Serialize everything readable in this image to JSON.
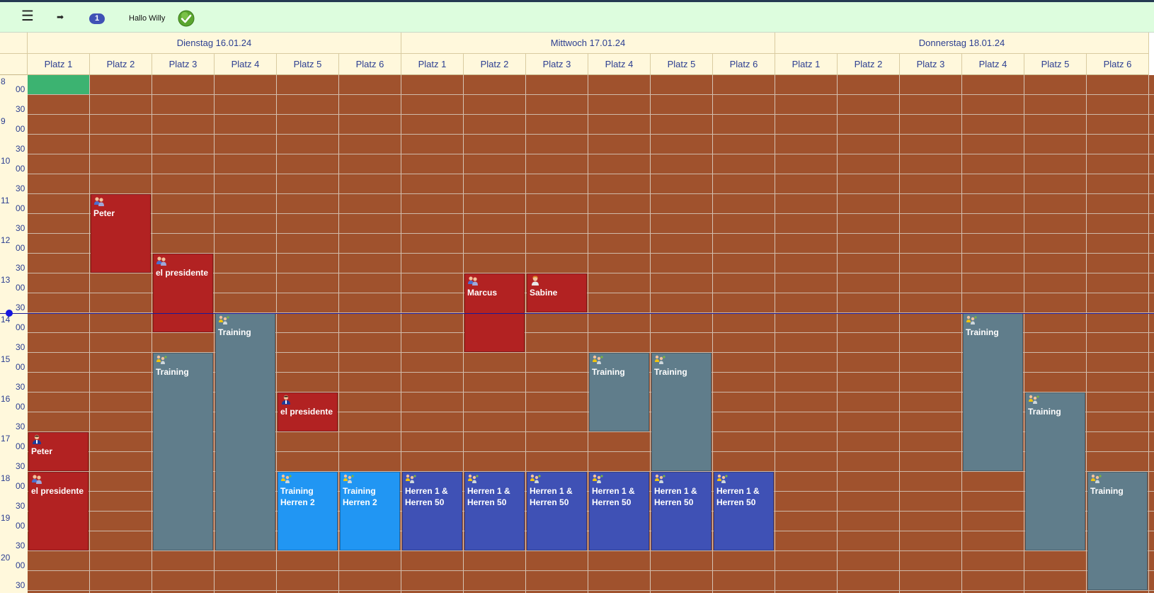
{
  "topbar": {
    "menu_icon": "☰",
    "logout_icon": "➡",
    "notification_count": "1",
    "greeting": "Hallo Willy"
  },
  "days": [
    {
      "label": "Dienstag 16.01.24"
    },
    {
      "label": "Mittwoch 17.01.24"
    },
    {
      "label": "Donnerstag 18.01.24"
    }
  ],
  "courts": [
    "Platz 1",
    "Platz 2",
    "Platz 3",
    "Platz 4",
    "Platz 5",
    "Platz 6"
  ],
  "hours": [
    "8",
    "9",
    "10",
    "11",
    "12",
    "13",
    "14",
    "15",
    "16",
    "17",
    "18",
    "19",
    "20"
  ],
  "minutes": [
    "00",
    "30"
  ],
  "colors": {
    "booking": "#b22222",
    "training": "#607d8b",
    "training_light": "#2196f3",
    "team": "#3f51b5",
    "free_slot": "#3cb371",
    "grid_bg": "#a0522d"
  },
  "events": [
    {
      "day": 0,
      "court": 1,
      "start": "11:00",
      "end": "13:00",
      "kind": "red",
      "icon": "group-icon",
      "label": "Peter"
    },
    {
      "day": 0,
      "court": 2,
      "start": "12:30",
      "end": "14:30",
      "kind": "red",
      "icon": "group-icon",
      "label": "el presidente"
    },
    {
      "day": 0,
      "court": 3,
      "start": "14:00",
      "end": "20:00",
      "kind": "gray",
      "icon": "training-icon",
      "label": "Training"
    },
    {
      "day": 0,
      "court": 2,
      "start": "15:00",
      "end": "20:00",
      "kind": "gray",
      "icon": "training-icon",
      "label": "Training"
    },
    {
      "day": 0,
      "court": 4,
      "start": "16:00",
      "end": "17:00",
      "kind": "red",
      "icon": "person-icon",
      "label": "el presidente"
    },
    {
      "day": 0,
      "court": 0,
      "start": "17:00",
      "end": "18:00",
      "kind": "red",
      "icon": "person-icon",
      "label": "Peter"
    },
    {
      "day": 0,
      "court": 0,
      "start": "18:00",
      "end": "20:00",
      "kind": "red",
      "icon": "group-icon",
      "label": "el presidente"
    },
    {
      "day": 0,
      "court": 4,
      "start": "18:00",
      "end": "20:00",
      "kind": "light",
      "icon": "training-icon",
      "label": "Training Herren 2"
    },
    {
      "day": 0,
      "court": 5,
      "start": "18:00",
      "end": "20:00",
      "kind": "light",
      "icon": "training-icon",
      "label": "Training Herren 2"
    },
    {
      "day": 1,
      "court": 1,
      "start": "13:00",
      "end": "15:00",
      "kind": "red",
      "icon": "group-icon",
      "label": "Marcus"
    },
    {
      "day": 1,
      "court": 2,
      "start": "13:00",
      "end": "14:00",
      "kind": "red",
      "icon": "person-female-icon",
      "label": "Sabine"
    },
    {
      "day": 1,
      "court": 3,
      "start": "15:00",
      "end": "17:00",
      "kind": "gray",
      "icon": "training-icon",
      "label": "Training"
    },
    {
      "day": 1,
      "court": 4,
      "start": "15:00",
      "end": "18:00",
      "kind": "gray",
      "icon": "training-icon",
      "label": "Training"
    },
    {
      "day": 1,
      "court": 0,
      "start": "18:00",
      "end": "20:00",
      "kind": "blue",
      "icon": "training-icon",
      "label": "Herren 1 & Herren 50"
    },
    {
      "day": 1,
      "court": 1,
      "start": "18:00",
      "end": "20:00",
      "kind": "blue",
      "icon": "training-icon",
      "label": "Herren 1 & Herren 50"
    },
    {
      "day": 1,
      "court": 2,
      "start": "18:00",
      "end": "20:00",
      "kind": "blue",
      "icon": "training-icon",
      "label": "Herren 1 & Herren 50"
    },
    {
      "day": 1,
      "court": 3,
      "start": "18:00",
      "end": "20:00",
      "kind": "blue",
      "icon": "training-icon",
      "label": "Herren 1 & Herren 50"
    },
    {
      "day": 1,
      "court": 4,
      "start": "18:00",
      "end": "20:00",
      "kind": "blue",
      "icon": "training-icon",
      "label": "Herren 1 & Herren 50"
    },
    {
      "day": 1,
      "court": 5,
      "start": "18:00",
      "end": "20:00",
      "kind": "blue",
      "icon": "training-icon",
      "label": "Herren 1 & Herren 50"
    },
    {
      "day": 2,
      "court": 3,
      "start": "14:00",
      "end": "18:00",
      "kind": "gray",
      "icon": "training-icon",
      "label": "Training"
    },
    {
      "day": 2,
      "court": 4,
      "start": "16:00",
      "end": "20:00",
      "kind": "gray",
      "icon": "training-icon",
      "label": "Training"
    },
    {
      "day": 2,
      "court": 5,
      "start": "18:00",
      "end": "21:00",
      "kind": "gray",
      "icon": "training-icon",
      "label": "Training"
    }
  ],
  "free_slots": [
    {
      "day": 0,
      "court": 0,
      "start": "08:00",
      "end": "08:30"
    }
  ],
  "current_time": "14:00"
}
